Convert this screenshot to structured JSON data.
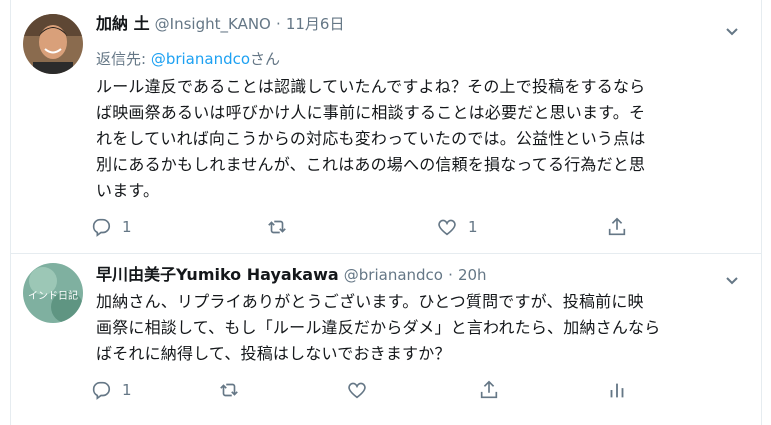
{
  "colors": {
    "accent": "#1da1f2",
    "secondary_text": "#657786",
    "border": "#e6ecf0"
  },
  "tweets": [
    {
      "name": "加納 土",
      "handle": "@Insight_KANO",
      "separator": "·",
      "time": "11月6日",
      "replying_prefix": "返信先: ",
      "replying_handle": "@brianandco",
      "replying_suffix": "さん",
      "lines": [
        "ルール違反であることは認識していたんですよね？その上で投稿をするなら",
        "ば映画祭あるいは呼びかけ人に事前に相談することは必要だと思います。そ",
        "れをしていれば向こうからの対応も変わっていたのでは。公益性という点は",
        "別にあるかもしれませんが、これはあの場への信頼を損なってる行為だと思",
        "います。"
      ],
      "actions": {
        "reply_icon": "reply-icon",
        "reply_count": "1",
        "retweet_icon": "retweet-icon",
        "retweet_count": "",
        "like_icon": "heart-icon",
        "like_count": "1",
        "share_icon": "share-icon"
      }
    },
    {
      "name": "早川由美子Yumiko Hayakawa",
      "handle": "@brianandco",
      "separator": "·",
      "time": "20h",
      "avatar_text": "インド日記",
      "lines": [
        "加納さん、リプライありがとうございます。ひとつ質問ですが、投稿前に映",
        "画祭に相談して、もし「ルール違反だからダメ」と言われたら、加納さんなら",
        "ばそれに納得して、投稿はしないでおきますか？"
      ],
      "actions": {
        "reply_icon": "reply-icon",
        "reply_count": "1",
        "retweet_icon": "retweet-icon",
        "like_icon": "heart-icon",
        "share_icon": "share-icon",
        "analytics_icon": "analytics-icon"
      }
    }
  ]
}
